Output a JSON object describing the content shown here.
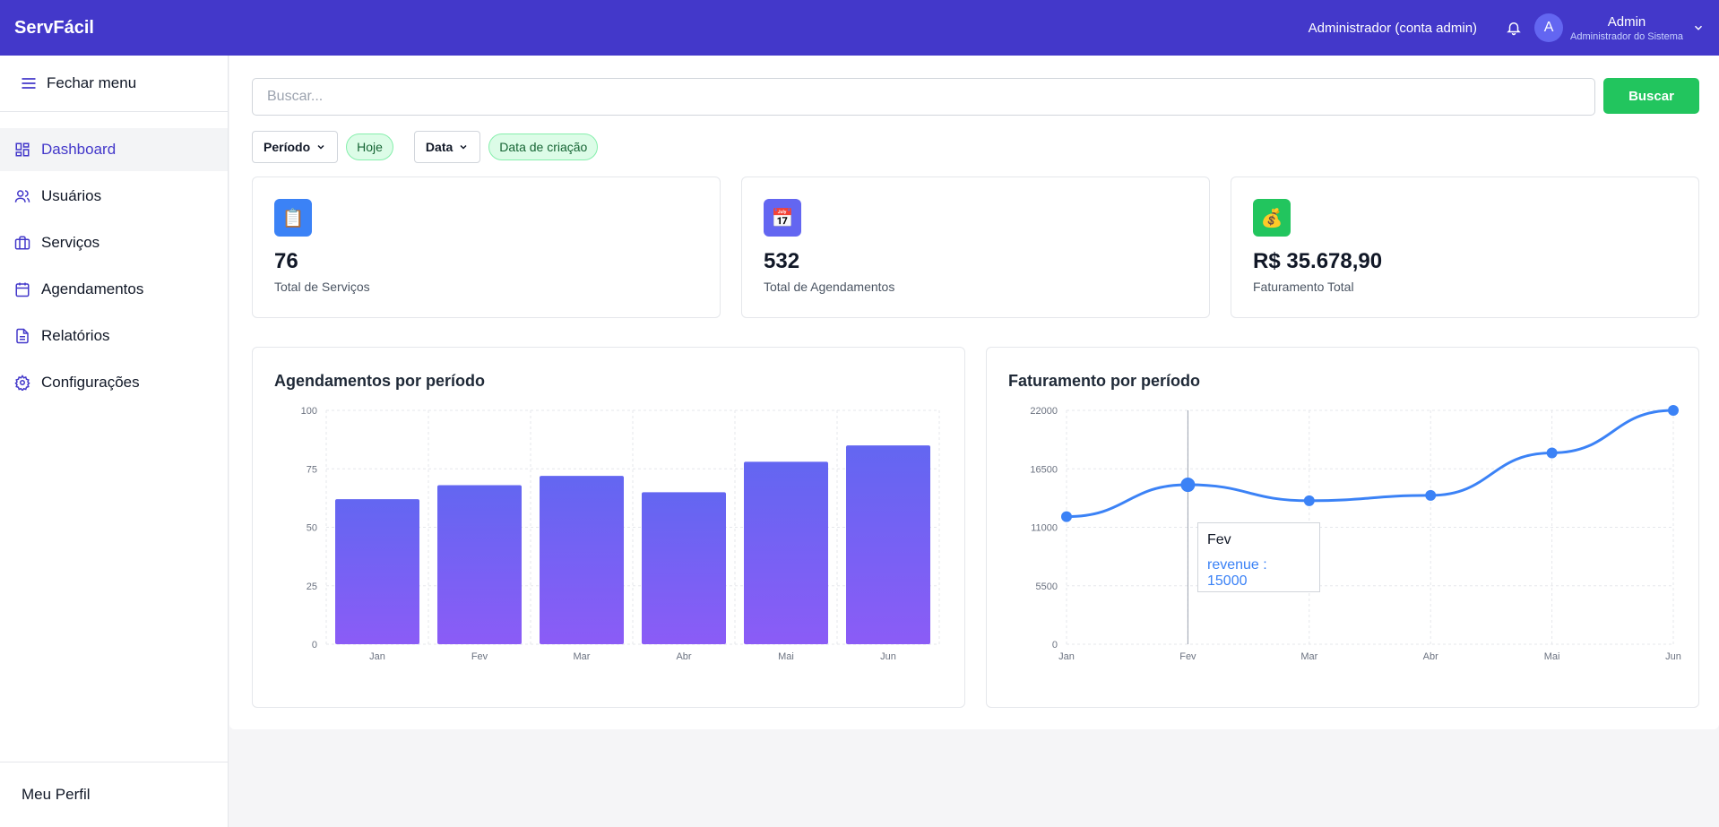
{
  "app": {
    "brand": "ServFácil"
  },
  "header": {
    "account_label": "Administrador (conta admin)",
    "avatar_letter": "A",
    "user_name": "Admin",
    "user_role": "Administrador do Sistema",
    "accent": "#4338ca"
  },
  "sidebar": {
    "toggle_label": "Fechar menu",
    "items": [
      {
        "label": "Dashboard",
        "icon": "grid-icon",
        "active": true
      },
      {
        "label": "Usuários",
        "icon": "users-icon"
      },
      {
        "label": "Serviços",
        "icon": "briefcase-icon"
      },
      {
        "label": "Agendamentos",
        "icon": "calendar-icon"
      },
      {
        "label": "Relatórios",
        "icon": "document-icon"
      },
      {
        "label": "Configurações",
        "icon": "gear-icon"
      }
    ],
    "profile_label": "Meu Perfil"
  },
  "search": {
    "placeholder": "Buscar...",
    "value": "",
    "button_label": "Buscar",
    "button_color": "#22c55e"
  },
  "filters": {
    "period_label": "Período",
    "period_chip": "Hoje",
    "date_label": "Data",
    "date_chip": "Data de criação"
  },
  "stats": [
    {
      "icon": "clipboard-icon",
      "glyph": "📋",
      "icon_bg": "#3b82f6",
      "value": "76",
      "label": "Total de Serviços"
    },
    {
      "icon": "calendar-icon",
      "glyph": "📅",
      "icon_bg": "#6366f1",
      "value": "532",
      "label": "Total de Agendamentos"
    },
    {
      "icon": "money-bag-icon",
      "glyph": "💰",
      "icon_bg": "#22c55e",
      "value": "R$ 35.678,90",
      "label": "Faturamento Total"
    }
  ],
  "chart_data": [
    {
      "type": "bar",
      "title": "Agendamentos por período",
      "categories": [
        "Jan",
        "Fev",
        "Mar",
        "Abr",
        "Mai",
        "Jun"
      ],
      "values": [
        62,
        68,
        72,
        65,
        78,
        85
      ],
      "ylim": [
        0,
        100
      ],
      "yticks": [
        0,
        25,
        50,
        75,
        100
      ],
      "grid": true,
      "color_top": "#6366f1",
      "color_bottom": "#8b5cf6"
    },
    {
      "type": "line",
      "title": "Faturamento por período",
      "categories": [
        "Jan",
        "Fev",
        "Mar",
        "Abr",
        "Mai",
        "Jun"
      ],
      "series": [
        {
          "name": "revenue",
          "values": [
            12000,
            15000,
            13500,
            14000,
            18000,
            22000
          ]
        }
      ],
      "ylim": [
        0,
        22000
      ],
      "yticks": [
        0,
        5500,
        11000,
        16500,
        22000
      ],
      "grid": true,
      "color": "#3b82f6",
      "tooltip": {
        "title": "Fev",
        "text": "revenue : 15000"
      }
    }
  ]
}
